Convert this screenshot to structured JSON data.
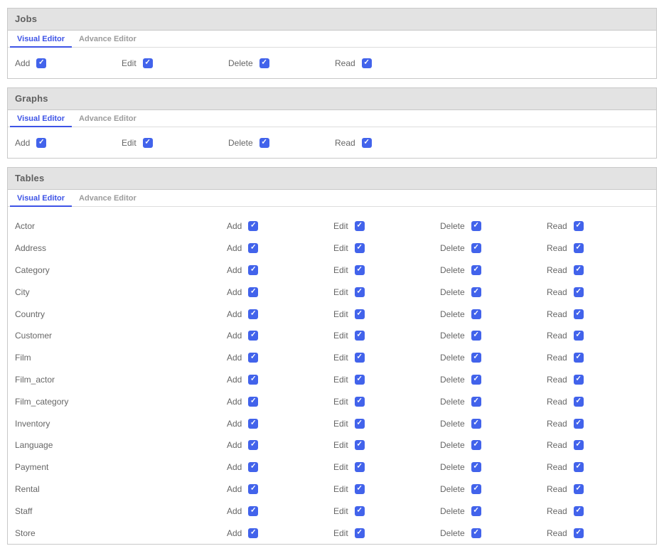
{
  "icons": {
    "check": "✓"
  },
  "colors": {
    "accent_blue": "#3d53e6",
    "checkbox_blue": "#4263eb",
    "header_gray": "#e3e3e3",
    "border_gray": "#c8c8c8",
    "text_gray": "#666666",
    "tab_inactive_gray": "#9b9b9b"
  },
  "panels": [
    {
      "title": "Jobs",
      "tabs": [
        "Visual Editor",
        "Advance Editor"
      ],
      "active_tab": "Visual Editor",
      "permissions": [
        {
          "label": "Add",
          "checked": true
        },
        {
          "label": "Edit",
          "checked": true
        },
        {
          "label": "Delete",
          "checked": true
        },
        {
          "label": "Read",
          "checked": true
        }
      ]
    },
    {
      "title": "Graphs",
      "tabs": [
        "Visual Editor",
        "Advance Editor"
      ],
      "active_tab": "Visual Editor",
      "permissions": [
        {
          "label": "Add",
          "checked": true
        },
        {
          "label": "Edit",
          "checked": true
        },
        {
          "label": "Delete",
          "checked": true
        },
        {
          "label": "Read",
          "checked": true
        }
      ]
    },
    {
      "title": "Tables",
      "tabs": [
        "Visual Editor",
        "Advance Editor"
      ],
      "active_tab": "Visual Editor",
      "columns": [
        "Add",
        "Edit",
        "Delete",
        "Read"
      ],
      "rows": [
        {
          "name": "Actor",
          "add": true,
          "edit": true,
          "delete": true,
          "read": true
        },
        {
          "name": "Address",
          "add": true,
          "edit": true,
          "delete": true,
          "read": true
        },
        {
          "name": "Category",
          "add": true,
          "edit": true,
          "delete": true,
          "read": true
        },
        {
          "name": "City",
          "add": true,
          "edit": true,
          "delete": true,
          "read": true
        },
        {
          "name": "Country",
          "add": true,
          "edit": true,
          "delete": true,
          "read": true
        },
        {
          "name": "Customer",
          "add": true,
          "edit": true,
          "delete": true,
          "read": true
        },
        {
          "name": "Film",
          "add": true,
          "edit": true,
          "delete": true,
          "read": true
        },
        {
          "name": "Film_actor",
          "add": true,
          "edit": true,
          "delete": true,
          "read": true
        },
        {
          "name": "Film_category",
          "add": true,
          "edit": true,
          "delete": true,
          "read": true
        },
        {
          "name": "Inventory",
          "add": true,
          "edit": true,
          "delete": true,
          "read": true
        },
        {
          "name": "Language",
          "add": true,
          "edit": true,
          "delete": true,
          "read": true
        },
        {
          "name": "Payment",
          "add": true,
          "edit": true,
          "delete": true,
          "read": true
        },
        {
          "name": "Rental",
          "add": true,
          "edit": true,
          "delete": true,
          "read": true
        },
        {
          "name": "Staff",
          "add": true,
          "edit": true,
          "delete": true,
          "read": true
        },
        {
          "name": "Store",
          "add": true,
          "edit": true,
          "delete": true,
          "read": true
        }
      ]
    }
  ]
}
